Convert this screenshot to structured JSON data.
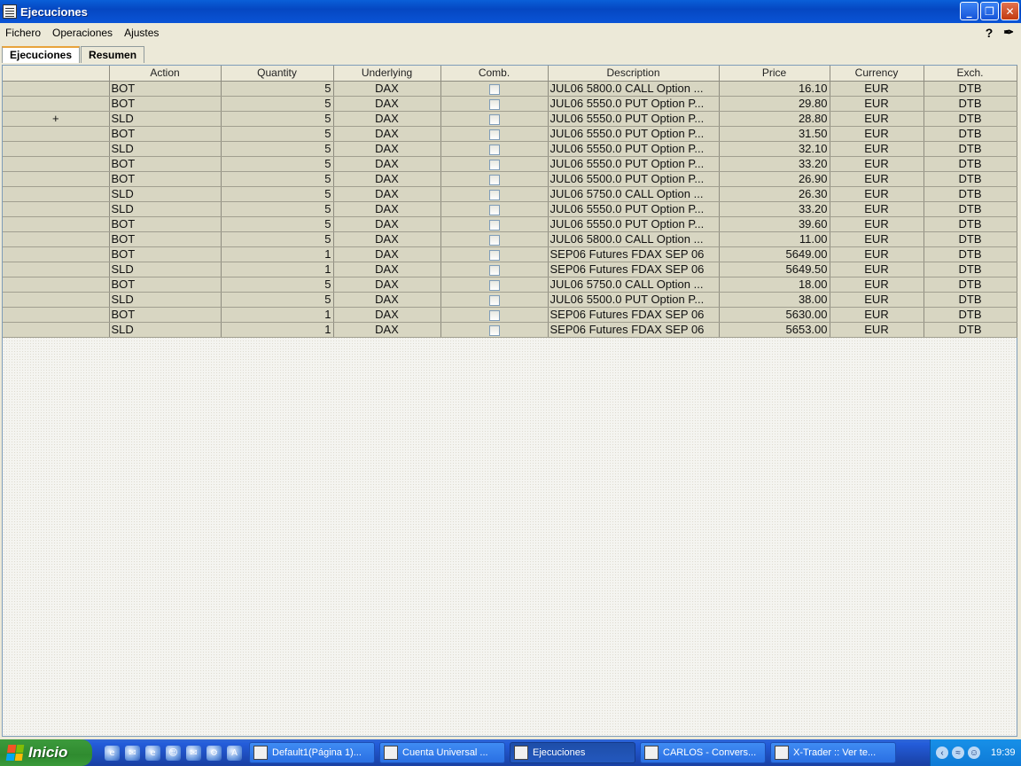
{
  "window": {
    "title": "Ejecuciones"
  },
  "menu": {
    "items": [
      "Fichero",
      "Operaciones",
      "Ajustes"
    ],
    "help": "?"
  },
  "tabs": [
    "Ejecuciones",
    "Resumen"
  ],
  "table": {
    "columns": [
      "",
      "Action",
      "Quantity",
      "Underlying",
      "Comb.",
      "Description",
      "Price",
      "Currency",
      "Exch."
    ],
    "rows": [
      [
        "",
        "BOT",
        "5",
        "DAX",
        "",
        "JUL06 5800.0 CALL Option ...",
        "16.10",
        "EUR",
        "DTB"
      ],
      [
        "",
        "BOT",
        "5",
        "DAX",
        "",
        "JUL06 5550.0 PUT Option P...",
        "29.80",
        "EUR",
        "DTB"
      ],
      [
        "+",
        "SLD",
        "5",
        "DAX",
        "",
        "JUL06 5550.0 PUT Option P...",
        "28.80",
        "EUR",
        "DTB"
      ],
      [
        "",
        "BOT",
        "5",
        "DAX",
        "",
        "JUL06 5550.0 PUT Option P...",
        "31.50",
        "EUR",
        "DTB"
      ],
      [
        "",
        "SLD",
        "5",
        "DAX",
        "",
        "JUL06 5550.0 PUT Option P...",
        "32.10",
        "EUR",
        "DTB"
      ],
      [
        "",
        "BOT",
        "5",
        "DAX",
        "",
        "JUL06 5550.0 PUT Option P...",
        "33.20",
        "EUR",
        "DTB"
      ],
      [
        "",
        "BOT",
        "5",
        "DAX",
        "",
        "JUL06 5500.0 PUT Option P...",
        "26.90",
        "EUR",
        "DTB"
      ],
      [
        "",
        "SLD",
        "5",
        "DAX",
        "",
        "JUL06 5750.0 CALL Option ...",
        "26.30",
        "EUR",
        "DTB"
      ],
      [
        "",
        "SLD",
        "5",
        "DAX",
        "",
        "JUL06 5550.0 PUT Option P...",
        "33.20",
        "EUR",
        "DTB"
      ],
      [
        "",
        "BOT",
        "5",
        "DAX",
        "",
        "JUL06 5550.0 PUT Option P...",
        "39.60",
        "EUR",
        "DTB"
      ],
      [
        "",
        "BOT",
        "5",
        "DAX",
        "",
        "JUL06 5800.0 CALL Option ...",
        "11.00",
        "EUR",
        "DTB"
      ],
      [
        "",
        "BOT",
        "1",
        "DAX",
        "",
        "SEP06 Futures FDAX SEP 06",
        "5649.00",
        "EUR",
        "DTB"
      ],
      [
        "",
        "SLD",
        "1",
        "DAX",
        "",
        "SEP06 Futures FDAX SEP 06",
        "5649.50",
        "EUR",
        "DTB"
      ],
      [
        "",
        "BOT",
        "5",
        "DAX",
        "",
        "JUL06 5750.0 CALL Option ...",
        "18.00",
        "EUR",
        "DTB"
      ],
      [
        "",
        "SLD",
        "5",
        "DAX",
        "",
        "JUL06 5500.0 PUT Option P...",
        "38.00",
        "EUR",
        "DTB"
      ],
      [
        "",
        "BOT",
        "1",
        "DAX",
        "",
        "SEP06 Futures FDAX SEP 06",
        "5630.00",
        "EUR",
        "DTB"
      ],
      [
        "",
        "SLD",
        "1",
        "DAX",
        "",
        "SEP06 Futures FDAX SEP 06",
        "5653.00",
        "EUR",
        "DTB"
      ]
    ]
  },
  "taskbar": {
    "start_label": "Inicio",
    "tasks": [
      "Default1(Página 1)...",
      "Cuenta Universal ...",
      "Ejecuciones",
      "CARLOS - Convers...",
      "X-Trader :: Ver te..."
    ],
    "active_task": "Ejecuciones",
    "clock": "19:39"
  }
}
